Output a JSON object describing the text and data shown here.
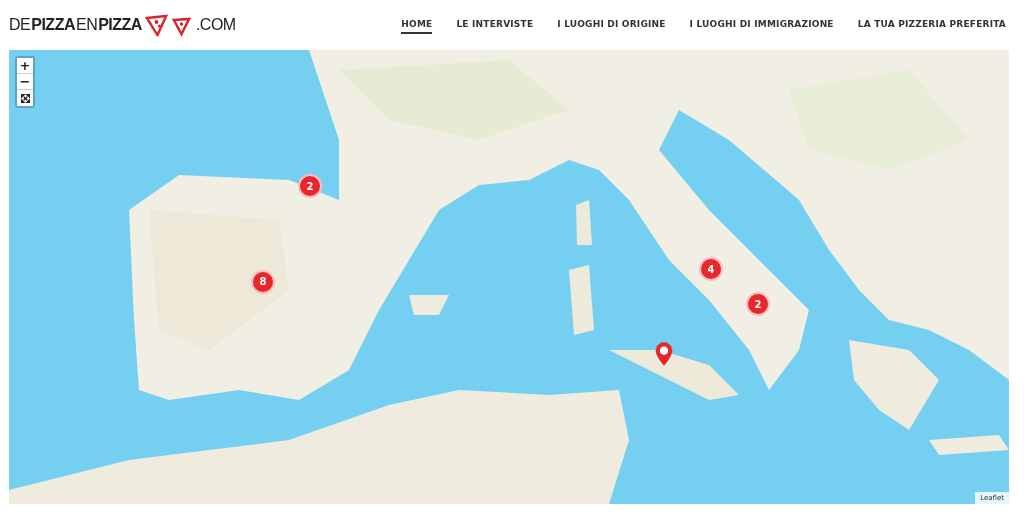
{
  "logo": {
    "parts": [
      {
        "text": "DE",
        "bold": false
      },
      {
        "text": "PIZZA",
        "bold": true
      },
      {
        "text": "EN",
        "bold": false
      },
      {
        "text": "PIZZA",
        "bold": true
      }
    ],
    "suffix": ".COM"
  },
  "nav": [
    {
      "label": "HOME",
      "selected": true
    },
    {
      "label": "LE INTERVISTE",
      "selected": false
    },
    {
      "label": "I LUOGHI DI ORIGINE",
      "selected": false
    },
    {
      "label": "I LUOGHI DI IMMIGRAZIONE",
      "selected": false
    },
    {
      "label": "LA TUA PIZZERIA PREFERITA",
      "selected": false
    }
  ],
  "map": {
    "controls": [
      {
        "kind": "zoom-in",
        "label": "+"
      },
      {
        "kind": "zoom-out",
        "label": "−"
      },
      {
        "kind": "fullscreen"
      }
    ],
    "markers": [
      {
        "kind": "cluster",
        "count": "2"
      },
      {
        "kind": "cluster",
        "count": "8"
      },
      {
        "kind": "cluster",
        "count": "4"
      },
      {
        "kind": "cluster",
        "count": "2"
      },
      {
        "kind": "pin"
      }
    ],
    "attribution": "Leaflet"
  }
}
